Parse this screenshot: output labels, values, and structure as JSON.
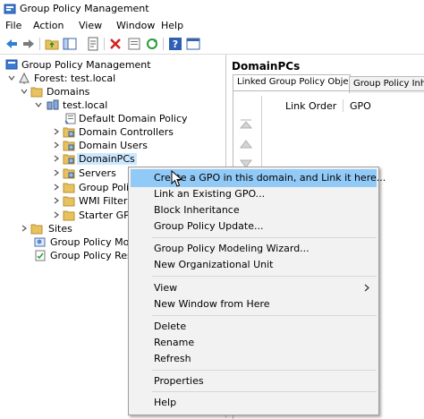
{
  "window": {
    "title": "Group Policy Management"
  },
  "menu": [
    "File",
    "Action",
    "View",
    "Window",
    "Help"
  ],
  "toolbar": [
    "back-icon",
    "forward-icon",
    "up-folder-icon",
    "show-hide-tree-icon",
    "properties-icon",
    "delete-icon",
    "export-icon",
    "refresh-icon",
    "help-icon",
    "console-icon"
  ],
  "tree": {
    "root": "Group Policy Management",
    "forest": "Forest: test.local",
    "domains": "Domains",
    "domain": "test.local",
    "items": [
      "Default Domain Policy",
      "Domain Controllers",
      "Domain Users",
      "DomainPCs",
      "Servers",
      "Group Polic",
      "WMI Filters",
      "Starter GPO"
    ],
    "sites": "Sites",
    "modeling": "Group Policy Mode",
    "results": "Group Policy Resul"
  },
  "right": {
    "title": "DomainPCs",
    "tabs": [
      "Linked Group Policy Objects",
      "Group Policy Inheritan"
    ],
    "columns": [
      "Link Order",
      "GPO"
    ]
  },
  "context_menu": {
    "items": [
      "Create a GPO in this domain, and Link it here...",
      "Link an Existing GPO...",
      "Block Inheritance",
      "Group Policy Update...",
      "Group Policy Modeling Wizard...",
      "New Organizational Unit",
      "View",
      "New Window from Here",
      "Delete",
      "Rename",
      "Refresh",
      "Properties",
      "Help"
    ]
  },
  "colors": {
    "highlight": "#91c9f7",
    "selection": "#cce8ff",
    "menu_bg": "#f2f2f2"
  }
}
